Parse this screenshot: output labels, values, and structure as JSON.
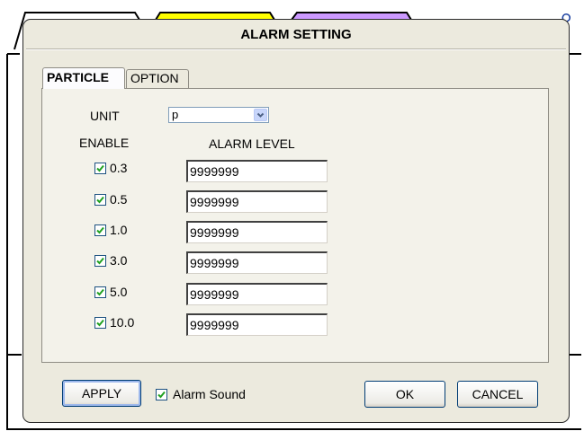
{
  "dialog": {
    "title": "ALARM SETTING"
  },
  "tabs": [
    {
      "label": "PARTICLE",
      "active": true
    },
    {
      "label": "OPTION",
      "active": false
    }
  ],
  "unit": {
    "label": "UNIT",
    "selected": "p"
  },
  "headers": {
    "enable": "ENABLE",
    "alarm_level": "ALARM LEVEL"
  },
  "rows": [
    {
      "size": "0.3",
      "checked": true,
      "level": "9999999"
    },
    {
      "size": "0.5",
      "checked": true,
      "level": "9999999"
    },
    {
      "size": "1.0",
      "checked": true,
      "level": "9999999"
    },
    {
      "size": "3.0",
      "checked": true,
      "level": "9999999"
    },
    {
      "size": "5.0",
      "checked": true,
      "level": "9999999"
    },
    {
      "size": "10.0",
      "checked": true,
      "level": "9999999"
    }
  ],
  "footer": {
    "apply_label": "APPLY",
    "alarm_sound_label": "Alarm Sound",
    "alarm_sound_checked": true,
    "ok_label": "OK",
    "cancel_label": "CANCEL"
  },
  "colors": {
    "background_tab_1": "#ffffff",
    "background_tab_2": "#ffff00",
    "background_tab_3": "#cc99ff",
    "check_mark": "#21a121",
    "dialog_bg": "#eceade"
  },
  "icons": {
    "select_arrow": "chevron-down-icon",
    "check": "check-icon"
  }
}
